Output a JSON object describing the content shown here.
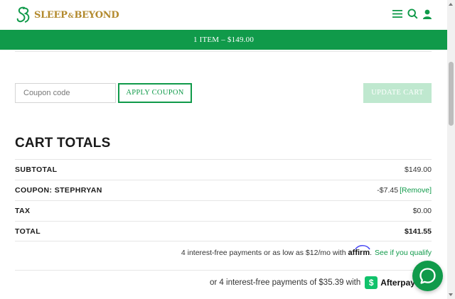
{
  "brand": {
    "name_part1": "SLEEP",
    "name_amp": "&",
    "name_part2": "BEYOND",
    "accent_color": "#109a4a",
    "gold_color": "#b38a2e"
  },
  "header": {
    "icons": [
      "menu-icon",
      "search-icon",
      "account-icon"
    ]
  },
  "cart_bar": {
    "label": "1 ITEM – $149.00"
  },
  "coupon": {
    "placeholder": "Coupon code",
    "apply_label": "APPLY COUPON",
    "update_label": "UPDATE CART"
  },
  "totals": {
    "title": "CART TOTALS",
    "subtotal_label": "SUBTOTAL",
    "subtotal_value": "$149.00",
    "coupon_label": "COUPON: STEPHRYAN",
    "coupon_value": "-$7.45",
    "coupon_remove": "[Remove]",
    "tax_label": "TAX",
    "tax_value": "$0.00",
    "total_label": "TOTAL",
    "total_value": "$141.55"
  },
  "affirm": {
    "text": "4 interest-free payments or as low as $12/mo with",
    "logo": "affirm",
    "period": ".",
    "link": "See if you qualify"
  },
  "afterpay": {
    "text": "or 4 interest-free payments of $35.39 with",
    "badge": "$",
    "word": "Afterpay"
  },
  "chat": {
    "icon": "chat-bubble-icon"
  }
}
